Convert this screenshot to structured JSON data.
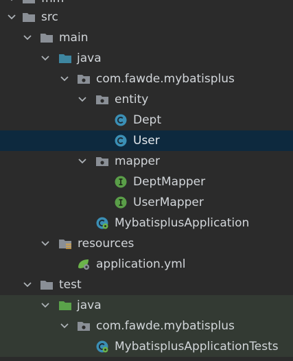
{
  "tree": {
    "partial_top_label": "fnm",
    "items": [
      {
        "label": "src"
      },
      {
        "label": "main"
      },
      {
        "label": "java"
      },
      {
        "label": "com.fawde.mybatisplus"
      },
      {
        "label": "entity"
      },
      {
        "label": "Dept"
      },
      {
        "label": "User"
      },
      {
        "label": "mapper"
      },
      {
        "label": "DeptMapper"
      },
      {
        "label": "UserMapper"
      },
      {
        "label": "MybatisplusApplication"
      },
      {
        "label": "resources"
      },
      {
        "label": "application.yml"
      },
      {
        "label": "test"
      },
      {
        "label": "java"
      },
      {
        "label": "com.fawde.mybatisplus"
      },
      {
        "label": "MybatisplusApplicationTests"
      }
    ]
  },
  "colors": {
    "background": "#2b2b2b",
    "selection": "#0d293e",
    "test_tint": "#333a33",
    "folder_gray": "#8a8f96",
    "source_folder_blue": "#3e86a0",
    "test_folder_green": "#5aa24a",
    "class_icon": "#3b8fb5",
    "interface_icon": "#5a9e48"
  }
}
